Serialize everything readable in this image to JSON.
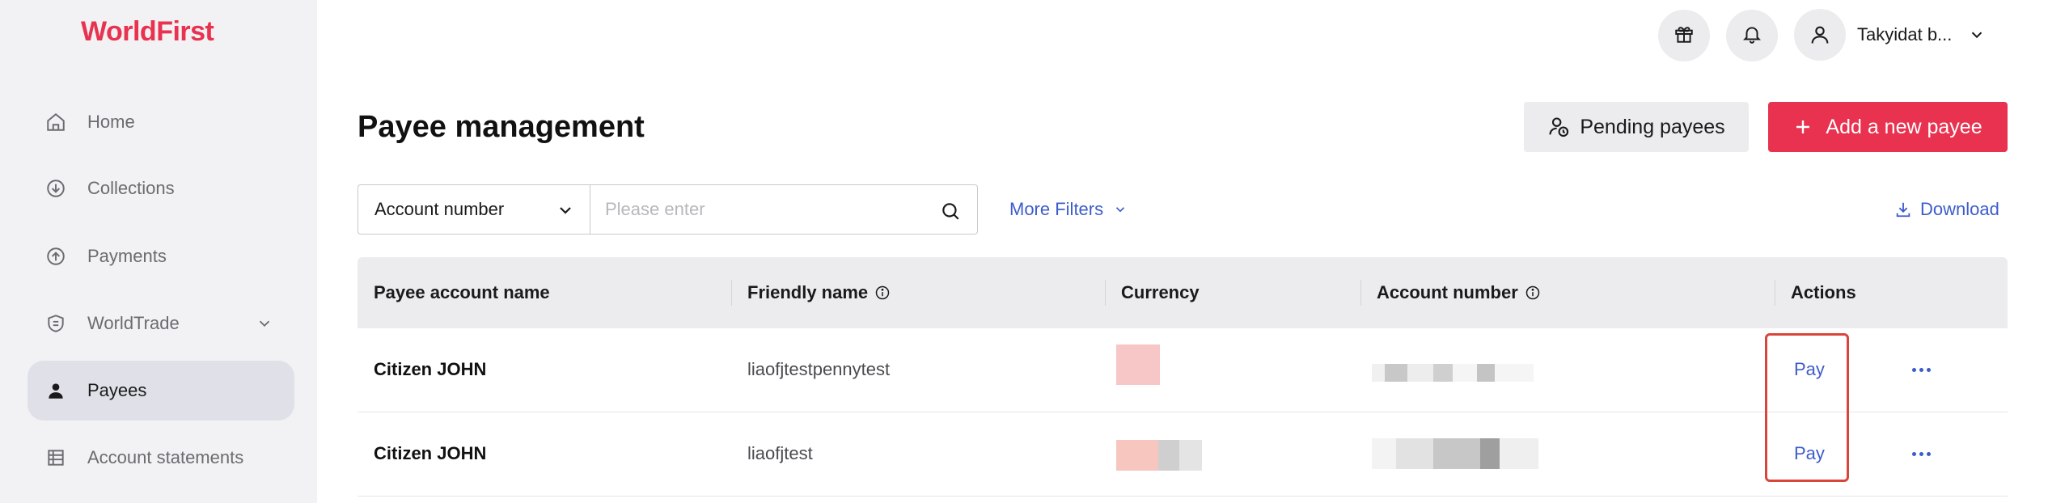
{
  "app": {
    "logo_text": "WorldFirst",
    "brand_color": "#e8324f",
    "accent_color": "#3d5ccc"
  },
  "sidebar": {
    "items": [
      {
        "label": "Home",
        "icon": "home-icon"
      },
      {
        "label": "Collections",
        "icon": "collections-icon"
      },
      {
        "label": "Payments",
        "icon": "payments-icon"
      },
      {
        "label": "WorldTrade",
        "icon": "worldtrade-icon",
        "has_submenu": true
      },
      {
        "label": "Payees",
        "icon": "payees-icon",
        "active": true
      },
      {
        "label": "Account statements",
        "icon": "statements-icon"
      }
    ]
  },
  "header": {
    "user_name": "Takyidat b...",
    "icons": [
      "gift-icon",
      "bell-icon",
      "user-icon",
      "chevron-down-icon"
    ]
  },
  "page": {
    "title": "Payee management",
    "pending_button": "Pending payees",
    "add_button": "Add a new payee"
  },
  "filters": {
    "select_value": "Account number",
    "search_placeholder": "Please enter",
    "more_filters": "More Filters",
    "download": "Download"
  },
  "table": {
    "columns": [
      "Payee account name",
      "Friendly name",
      "Currency",
      "Account number",
      "Actions"
    ],
    "rows": [
      {
        "payee_account_name": "Citizen JOHN",
        "friendly_name": "liaofjtestpennytest",
        "currency": "",
        "account_number": "",
        "action": "Pay"
      },
      {
        "payee_account_name": "Citizen JOHN",
        "friendly_name": "liaofjtest",
        "currency": "",
        "account_number": "",
        "action": "Pay"
      }
    ]
  }
}
